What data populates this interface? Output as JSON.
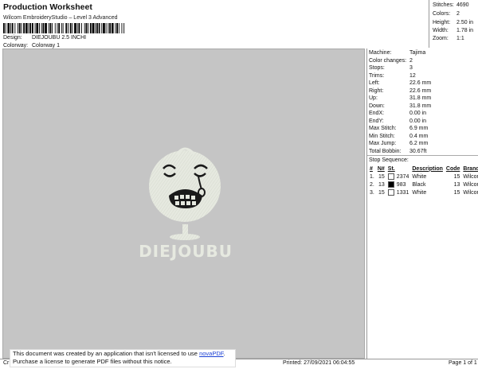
{
  "header": {
    "title": "Production Worksheet",
    "subtitle": "Wilcom EmbroideryStudio – Level 3 Advanced",
    "design_label": "Design:",
    "design_value": "DIEJOUBU 2.5 INCHI",
    "colorway_label": "Colorway:",
    "colorway_value": "Colorway 1"
  },
  "stats": [
    {
      "label": "Stitches:",
      "value": "4690"
    },
    {
      "label": "Colors:",
      "value": "2"
    },
    {
      "label": "Height:",
      "value": "2.50 in"
    },
    {
      "label": "Width:",
      "value": "1.78 in"
    },
    {
      "label": "Zoom:",
      "value": "1:1"
    }
  ],
  "design_text": "DIEJOUBU",
  "properties": [
    {
      "label": "Machine:",
      "value": "Tajima"
    },
    {
      "label": "Color changes:",
      "value": "2"
    },
    {
      "label": "Stops:",
      "value": "3"
    },
    {
      "label": "Trims:",
      "value": "12"
    },
    {
      "label": "Left:",
      "value": "22.6 mm"
    },
    {
      "label": "Right:",
      "value": "22.6 mm"
    },
    {
      "label": "Up:",
      "value": "31.8 mm"
    },
    {
      "label": "Down:",
      "value": "31.8 mm"
    },
    {
      "label": "EndX:",
      "value": "0.00 in"
    },
    {
      "label": "EndY:",
      "value": "0.00 in"
    },
    {
      "label": "Max Stitch:",
      "value": "6.9 mm"
    },
    {
      "label": "Min Stitch:",
      "value": "0.4 mm"
    },
    {
      "label": "Max Jump:",
      "value": "6.2 mm"
    },
    {
      "label": "Total Bobbin:",
      "value": "30.67ft"
    }
  ],
  "stop_sequence": {
    "title": "Stop Sequence:",
    "headers": [
      "#",
      "N#",
      "St.",
      "Description",
      "Code",
      "Brand"
    ],
    "rows": [
      {
        "num": "1.",
        "n": "15",
        "color": "#ffffff",
        "st": "2374",
        "desc": "White",
        "code": "15",
        "brand": "Wilcom"
      },
      {
        "num": "2.",
        "n": "13",
        "color": "#000000",
        "st": "983",
        "desc": "Black",
        "code": "13",
        "brand": "Wilcom"
      },
      {
        "num": "3.",
        "n": "15",
        "color": "#ffffff",
        "st": "1331",
        "desc": "White",
        "code": "15",
        "brand": "Wilcom"
      }
    ]
  },
  "footer": {
    "notice_line1": "This document was created by an application that isn't licensed to use ",
    "notice_link": "novaPDF",
    "notice_line1_end": ".",
    "notice_line2": "Purchase a license to generate PDF files without this notice.",
    "cr": "Cr",
    "printed": "Printed: 27/09/2021 06:04:55",
    "page": "Page 1 of 1"
  },
  "colors": {
    "canvas_bg": "#c5c5c5",
    "thread_white": "#e8ebe2",
    "thread_black": "#1a1a1a"
  }
}
